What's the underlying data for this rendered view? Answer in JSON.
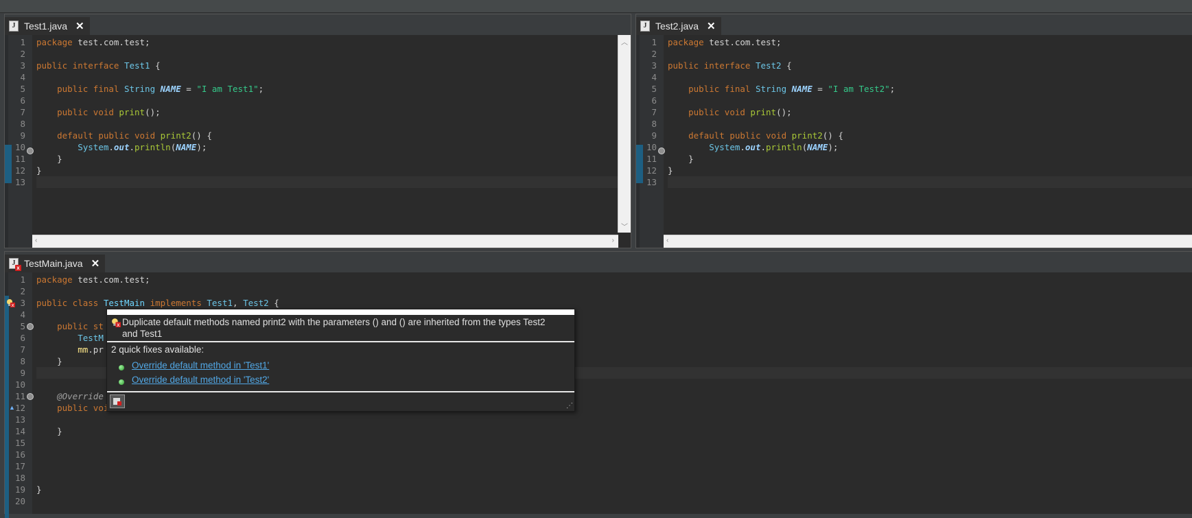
{
  "top_panes": [
    {
      "tab_title": "Test1.java",
      "lines": [
        {
          "n": "1",
          "tokens": [
            {
              "c": "kw",
              "t": "package"
            },
            {
              "c": "",
              "t": " test.com.test;"
            }
          ]
        },
        {
          "n": "2",
          "tokens": []
        },
        {
          "n": "3",
          "tokens": [
            {
              "c": "kw",
              "t": "public interface "
            },
            {
              "c": "ty",
              "t": "Test1"
            },
            {
              "c": "",
              "t": " {"
            }
          ]
        },
        {
          "n": "4",
          "tokens": []
        },
        {
          "n": "5",
          "tokens": [
            {
              "c": "",
              "t": "    "
            },
            {
              "c": "kw",
              "t": "public final "
            },
            {
              "c": "ty",
              "t": "String "
            },
            {
              "c": "fld",
              "t": "NAME"
            },
            {
              "c": "",
              "t": " = "
            },
            {
              "c": "str",
              "t": "\"I am Test1\""
            },
            {
              "c": "",
              "t": ";"
            }
          ]
        },
        {
          "n": "6",
          "tokens": []
        },
        {
          "n": "7",
          "tokens": [
            {
              "c": "",
              "t": "    "
            },
            {
              "c": "kw",
              "t": "public void "
            },
            {
              "c": "fn",
              "t": "print"
            },
            {
              "c": "",
              "t": "();"
            }
          ]
        },
        {
          "n": "8",
          "tokens": []
        },
        {
          "n": "9",
          "tokens": [
            {
              "c": "",
              "t": "    "
            },
            {
              "c": "kw",
              "t": "default public void "
            },
            {
              "c": "fn",
              "t": "print2"
            },
            {
              "c": "",
              "t": "() {"
            }
          ]
        },
        {
          "n": "10",
          "tokens": [
            {
              "c": "",
              "t": "        "
            },
            {
              "c": "ty",
              "t": "System"
            },
            {
              "c": "",
              "t": "."
            },
            {
              "c": "fld",
              "t": "out"
            },
            {
              "c": "",
              "t": "."
            },
            {
              "c": "fn",
              "t": "println"
            },
            {
              "c": "",
              "t": "("
            },
            {
              "c": "fld",
              "t": "NAME"
            },
            {
              "c": "",
              "t": ");"
            }
          ]
        },
        {
          "n": "11",
          "tokens": [
            {
              "c": "",
              "t": "    }"
            }
          ]
        },
        {
          "n": "12",
          "tokens": [
            {
              "c": "",
              "t": "}"
            }
          ]
        },
        {
          "n": "13",
          "tokens": []
        }
      ]
    },
    {
      "tab_title": "Test2.java",
      "lines": [
        {
          "n": "1",
          "tokens": [
            {
              "c": "kw",
              "t": "package"
            },
            {
              "c": "",
              "t": " test.com.test;"
            }
          ]
        },
        {
          "n": "2",
          "tokens": []
        },
        {
          "n": "3",
          "tokens": [
            {
              "c": "kw",
              "t": "public interface "
            },
            {
              "c": "ty",
              "t": "Test2"
            },
            {
              "c": "",
              "t": " {"
            }
          ]
        },
        {
          "n": "4",
          "tokens": []
        },
        {
          "n": "5",
          "tokens": [
            {
              "c": "",
              "t": "    "
            },
            {
              "c": "kw",
              "t": "public final "
            },
            {
              "c": "ty",
              "t": "String "
            },
            {
              "c": "fld",
              "t": "NAME"
            },
            {
              "c": "",
              "t": " = "
            },
            {
              "c": "str",
              "t": "\"I am Test2\""
            },
            {
              "c": "",
              "t": ";"
            }
          ]
        },
        {
          "n": "6",
          "tokens": []
        },
        {
          "n": "7",
          "tokens": [
            {
              "c": "",
              "t": "    "
            },
            {
              "c": "kw",
              "t": "public void "
            },
            {
              "c": "fn",
              "t": "print"
            },
            {
              "c": "",
              "t": "();"
            }
          ]
        },
        {
          "n": "8",
          "tokens": []
        },
        {
          "n": "9",
          "tokens": [
            {
              "c": "",
              "t": "    "
            },
            {
              "c": "kw",
              "t": "default public void "
            },
            {
              "c": "fn",
              "t": "print2"
            },
            {
              "c": "",
              "t": "() {"
            }
          ]
        },
        {
          "n": "10",
          "tokens": [
            {
              "c": "",
              "t": "        "
            },
            {
              "c": "ty",
              "t": "System"
            },
            {
              "c": "",
              "t": "."
            },
            {
              "c": "fld",
              "t": "out"
            },
            {
              "c": "",
              "t": "."
            },
            {
              "c": "fn",
              "t": "println"
            },
            {
              "c": "",
              "t": "("
            },
            {
              "c": "fld",
              "t": "NAME"
            },
            {
              "c": "",
              "t": ");"
            }
          ]
        },
        {
          "n": "11",
          "tokens": [
            {
              "c": "",
              "t": "    }"
            }
          ]
        },
        {
          "n": "12",
          "tokens": [
            {
              "c": "",
              "t": "}"
            }
          ]
        },
        {
          "n": "13",
          "tokens": []
        }
      ]
    }
  ],
  "bottom_pane": {
    "tab_title": "TestMain.java",
    "lines": [
      {
        "n": "1",
        "tokens": [
          {
            "c": "kw",
            "t": "package"
          },
          {
            "c": "",
            "t": " test.com.test;"
          }
        ]
      },
      {
        "n": "2",
        "tokens": []
      },
      {
        "n": "3",
        "tokens": [
          {
            "c": "kw",
            "t": "public class "
          },
          {
            "c": "cls",
            "t": "TestMain"
          },
          {
            "c": "kw",
            "t": " implements "
          },
          {
            "c": "ty",
            "t": "Test1"
          },
          {
            "c": "",
            "t": ", "
          },
          {
            "c": "ty",
            "t": "Test2"
          },
          {
            "c": "",
            "t": " {"
          }
        ]
      },
      {
        "n": "4",
        "tokens": []
      },
      {
        "n": "5",
        "tokens": [
          {
            "c": "",
            "t": "    "
          },
          {
            "c": "kw",
            "t": "public st"
          }
        ]
      },
      {
        "n": "6",
        "tokens": [
          {
            "c": "",
            "t": "        "
          },
          {
            "c": "ty",
            "t": "TestM"
          }
        ]
      },
      {
        "n": "7",
        "tokens": [
          {
            "c": "",
            "t": "        "
          },
          {
            "c": "yel",
            "t": "mm"
          },
          {
            "c": "",
            "t": ".pr"
          }
        ]
      },
      {
        "n": "8",
        "tokens": [
          {
            "c": "",
            "t": "    }"
          }
        ]
      },
      {
        "n": "9",
        "tokens": []
      },
      {
        "n": "10",
        "tokens": []
      },
      {
        "n": "11",
        "tokens": [
          {
            "c": "",
            "t": "    "
          },
          {
            "c": "ann",
            "t": "@Override"
          }
        ]
      },
      {
        "n": "12",
        "tokens": [
          {
            "c": "",
            "t": "    "
          },
          {
            "c": "kw",
            "t": "public voi"
          }
        ]
      },
      {
        "n": "13",
        "tokens": []
      },
      {
        "n": "14",
        "tokens": [
          {
            "c": "",
            "t": "    }"
          }
        ]
      },
      {
        "n": "15",
        "tokens": []
      },
      {
        "n": "16",
        "tokens": []
      },
      {
        "n": "17",
        "tokens": []
      },
      {
        "n": "18",
        "tokens": []
      },
      {
        "n": "19",
        "tokens": [
          {
            "c": "",
            "t": "}"
          }
        ]
      },
      {
        "n": "20",
        "tokens": []
      }
    ]
  },
  "quickfix_popup": {
    "message": "Duplicate default methods named print2 with the parameters () and () are inherited from the types Test2 and Test1",
    "count_label": "2 quick fixes available:",
    "fixes": [
      "Override default method in 'Test1'",
      "Override default method in 'Test2'"
    ]
  },
  "icons": {
    "file": "java-file-icon",
    "file_error": "java-file-error-icon",
    "close": "close-icon",
    "error_bulb": "error-lightbulb-icon",
    "fix": "quickfix-bullet-icon",
    "settings": "popup-settings-icon",
    "resize": "resize-grip-icon"
  },
  "colors": {
    "keyword": "#cc7832",
    "type": "#6cc5e6",
    "string": "#35c98a",
    "link": "#52a8e6"
  }
}
